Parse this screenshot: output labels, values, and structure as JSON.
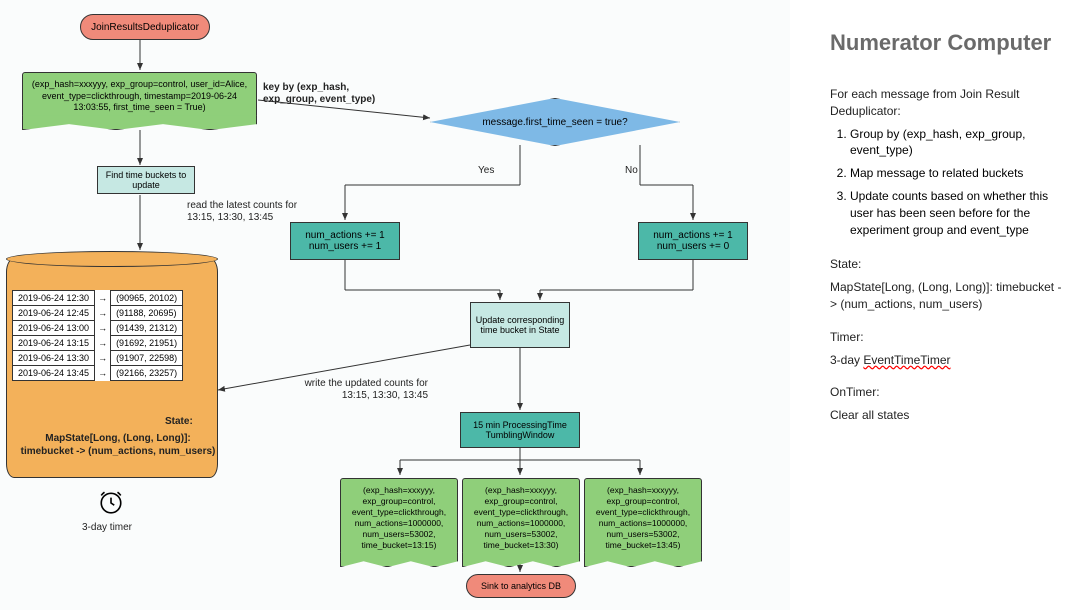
{
  "title": "Numerator Computer",
  "intro": "For each message from Join Result Deduplicator:",
  "steps": [
    "Group by (exp_hash, exp_group, event_type)",
    "Map message to related buckets",
    "Update counts based on whether this user has been seen before for the experiment group and event_type"
  ],
  "state_label": "State:",
  "state_desc": "MapState[Long, (Long, Long)]: timebucket -> (num_actions, num_users)",
  "timer_label": "Timer:",
  "timer_desc_prefix": "3-day ",
  "timer_desc_wavy": "EventTimeTimer",
  "ontimer_label": "OnTimer:",
  "ontimer_desc": "Clear all states",
  "start_node": "JoinResultsDeduplicator",
  "input_msg": "(exp_hash=xxxyyy, exp_group=control, user_id=Alice, event_type=clickthrough, timestamp=2019-06-24 13:03:55, first_time_seen = True)",
  "key_by_label": "key by (exp_hash, exp_group, event_type)",
  "decision": "message.first_time_seen = true?",
  "yes": "Yes",
  "no": "No",
  "find_buckets": "Find time buckets to update",
  "read_counts": "read the latest counts for 13:15, 13:30, 13:45",
  "inc_yes": "num_actions += 1\nnum_users += 1",
  "inc_no": "num_actions += 1\nnum_users += 0",
  "update_bucket": "Update corresponding time bucket in State",
  "write_counts": "write the updated counts for 13:15, 13:30, 13:45",
  "tumbling": "15 min ProcessingTime TumblingWindow",
  "out_msgs": [
    "(exp_hash=xxxyyy, exp_group=control, event_type=clickthrough, num_actions=1000000, num_users=53002, time_bucket=13:15)",
    "(exp_hash=xxxyyy, exp_group=control, event_type=clickthrough, num_actions=1000000, num_users=53002, time_bucket=13:30)",
    "(exp_hash=xxxyyy, exp_group=control, event_type=clickthrough, num_actions=1000000, num_users=53002, time_bucket=13:45)"
  ],
  "sink": "Sink to analytics DB",
  "state_table": [
    [
      "2019-06-24 12:30",
      "(90965, 20102)"
    ],
    [
      "2019-06-24 12:45",
      "(91188, 20695)"
    ],
    [
      "2019-06-24 13:00",
      "(91439, 21312)"
    ],
    [
      "2019-06-24 13:15",
      "(91692, 21951)"
    ],
    [
      "2019-06-24 13:30",
      "(91907, 22598)"
    ],
    [
      "2019-06-24 13:45",
      "(92166, 23257)"
    ]
  ],
  "cyl_state_label": "State:",
  "cyl_state_desc": "MapState[Long, (Long, Long)]:\ntimebucket -> (num_actions, num_users)",
  "timer_caption": "3-day timer"
}
